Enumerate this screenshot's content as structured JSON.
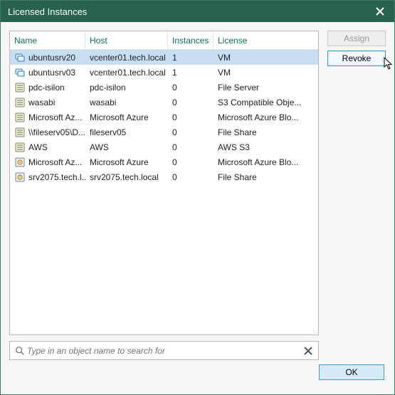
{
  "window": {
    "title": "Licensed Instances"
  },
  "buttons": {
    "assign": "Assign",
    "revoke": "Revoke",
    "ok": "OK"
  },
  "search": {
    "placeholder": "Type in an object name to search for"
  },
  "columns": {
    "name": "Name",
    "host": "Host",
    "instances": "Instances",
    "license": "License"
  },
  "rows": [
    {
      "icon": "vm",
      "name": "ubuntusrv20",
      "host": "vcenter01.tech.local",
      "instances": "1",
      "license": "VM",
      "selected": true
    },
    {
      "icon": "vm",
      "name": "ubuntusrv03",
      "host": "vcenter01.tech.local",
      "instances": "1",
      "license": "VM"
    },
    {
      "icon": "nas",
      "name": "pdc-isilon",
      "host": "pdc-isilon",
      "instances": "0",
      "license": "File Server"
    },
    {
      "icon": "nas",
      "name": "wasabi",
      "host": "wasabi",
      "instances": "0",
      "license": "S3 Compatible Obje..."
    },
    {
      "icon": "nas",
      "name": "Microsoft Az...",
      "host": "Microsoft Azure",
      "instances": "0",
      "license": "Microsoft Azure Blo..."
    },
    {
      "icon": "nas",
      "name": "\\\\fileserv05\\D...",
      "host": "fileserv05",
      "instances": "0",
      "license": "File Share"
    },
    {
      "icon": "nas",
      "name": "AWS",
      "host": "AWS",
      "instances": "0",
      "license": "AWS S3"
    },
    {
      "icon": "object",
      "name": "Microsoft Az...",
      "host": "Microsoft Azure",
      "instances": "0",
      "license": "Microsoft Azure Blo..."
    },
    {
      "icon": "object",
      "name": "srv2075.tech.l...",
      "host": "srv2075.tech.local",
      "instances": "0",
      "license": "File Share"
    }
  ]
}
